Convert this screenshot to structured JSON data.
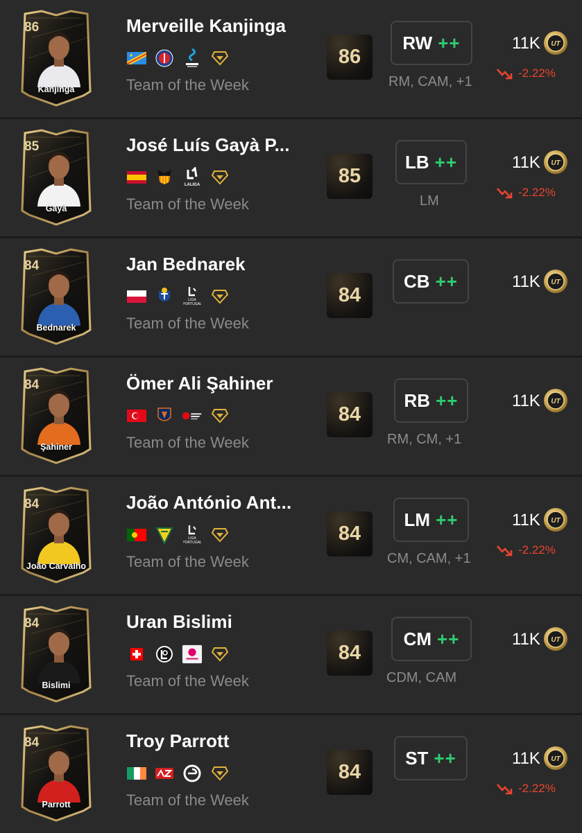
{
  "players": [
    {
      "card_rating": "86",
      "card_name": "Kanjinga",
      "name": "Merveille Kanjinga",
      "version": "Team of the Week",
      "ovr": "86",
      "position": "RW",
      "plus": "++",
      "alt_positions": "RM, CAM, +1",
      "price": "11K",
      "trend": "-2.22%",
      "flag": "cod",
      "club_icon": "psg-crest-icon",
      "league_icon": "arkema-premiere-ligue-icon",
      "kit_color": "#e9e9ee"
    },
    {
      "card_rating": "85",
      "card_name": "Gayà",
      "name": "José Luís Gayà P...",
      "version": "Team of the Week",
      "ovr": "85",
      "position": "LB",
      "plus": "++",
      "alt_positions": "LM",
      "price": "11K",
      "trend": "-2.22%",
      "flag": "esp",
      "club_icon": "valencia-bat-icon",
      "league_icon": "laliga-icon",
      "kit_color": "#f2f2f2"
    },
    {
      "card_rating": "84",
      "card_name": "Bednarek",
      "name": "Jan Bednarek",
      "version": "Team of the Week",
      "ovr": "84",
      "position": "CB",
      "plus": "++",
      "alt_positions": "",
      "price": "11K",
      "trend": "",
      "flag": "pol",
      "club_icon": "fc-porto-crest-icon",
      "league_icon": "liga-portugal-icon",
      "kit_color": "#2b5fb0"
    },
    {
      "card_rating": "84",
      "card_name": "Şahiner",
      "name": "Ömer Ali Şahiner",
      "version": "Team of the Week",
      "ovr": "84",
      "position": "RB",
      "plus": "++",
      "alt_positions": "RM, CM, +1",
      "price": "11K",
      "trend": "",
      "flag": "tur",
      "club_icon": "basaksehir-crest-icon",
      "league_icon": "super-lig-icon",
      "kit_color": "#e36c1e"
    },
    {
      "card_rating": "84",
      "card_name": "João Carvalho",
      "name": "João António Ant...",
      "version": "Team of the Week",
      "ovr": "84",
      "position": "LM",
      "plus": "++",
      "alt_positions": "CM, CAM, +1",
      "price": "11K",
      "trend": "-2.22%",
      "flag": "por",
      "club_icon": "estoril-crest-icon",
      "league_icon": "liga-portugal-icon",
      "kit_color": "#f2c820"
    },
    {
      "card_rating": "84",
      "card_name": "Bislimi",
      "name": "Uran Bislimi",
      "version": "Team of the Week",
      "ovr": "84",
      "position": "CM",
      "plus": "++",
      "alt_positions": "CDM, CAM",
      "price": "11K",
      "trend": "",
      "flag": "sui",
      "club_icon": "lugano-crest-icon",
      "league_icon": "swiss-super-league-icon",
      "kit_color": "#1a1a1a"
    },
    {
      "card_rating": "84",
      "card_name": "Parrott",
      "name": "Troy Parrott",
      "version": "Team of the Week",
      "ovr": "84",
      "position": "ST",
      "plus": "++",
      "alt_positions": "",
      "price": "11K",
      "trend": "-2.22%",
      "flag": "irl",
      "club_icon": "az-alkmaar-crest-icon",
      "league_icon": "eredivisie-icon",
      "kit_color": "#d2201f"
    }
  ],
  "colors": {
    "background": "#2a2a2a",
    "separator": "#1c1c1c",
    "accent_green": "#2ecc71",
    "trend_red": "#e8452f",
    "card_gold": "#c9a85c"
  },
  "icons": {
    "coin": "ut-coin-icon",
    "trend": "trend-down-icon",
    "chemistry": "chemistry-style-icon"
  },
  "coin_text": "UT"
}
